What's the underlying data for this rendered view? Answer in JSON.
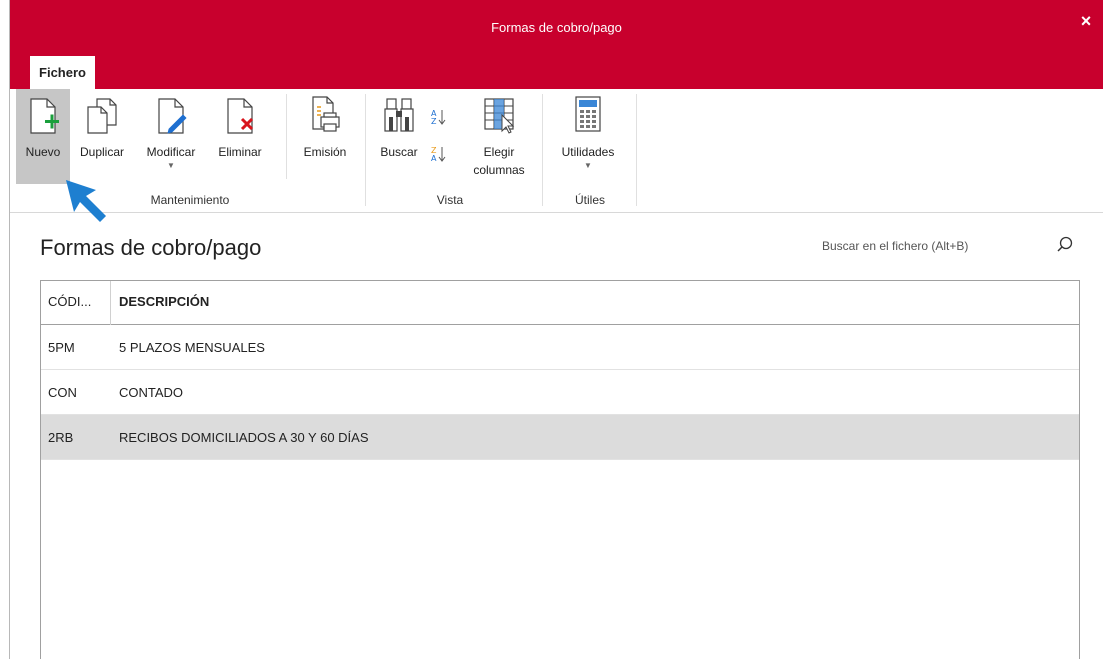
{
  "window": {
    "title": "Formas de cobro/pago",
    "close": "×"
  },
  "ribbon": {
    "tab": "Fichero",
    "buttons": {
      "nuevo": "Nuevo",
      "duplicar": "Duplicar",
      "modificar": "Modificar",
      "eliminar": "Eliminar",
      "emision": "Emisión",
      "buscar": "Buscar",
      "elegir_l1": "Elegir",
      "elegir_l2": "columnas",
      "utilidades": "Utilidades"
    },
    "groups": {
      "mantenimiento": "Mantenimiento",
      "vista": "Vista",
      "utiles": "Útiles"
    },
    "colors": {
      "accent": "#c8002d",
      "new_plus": "#1a9f3c",
      "delete_x": "#d8141c",
      "edit_pen": "#1e6fd0"
    }
  },
  "main": {
    "title": "Formas de cobro/pago",
    "search_placeholder": "Buscar en el fichero (Alt+B)",
    "table": {
      "headers": {
        "code": "CÓDI...",
        "description": "DESCRIPCIÓN"
      },
      "rows": [
        {
          "code": "5PM",
          "description": "5 PLAZOS MENSUALES"
        },
        {
          "code": "CON",
          "description": "CONTADO"
        },
        {
          "code": "2RB",
          "description": "RECIBOS DOMICILIADOS A 30 Y 60 DÍAS"
        }
      ],
      "selected_row": 2
    }
  }
}
